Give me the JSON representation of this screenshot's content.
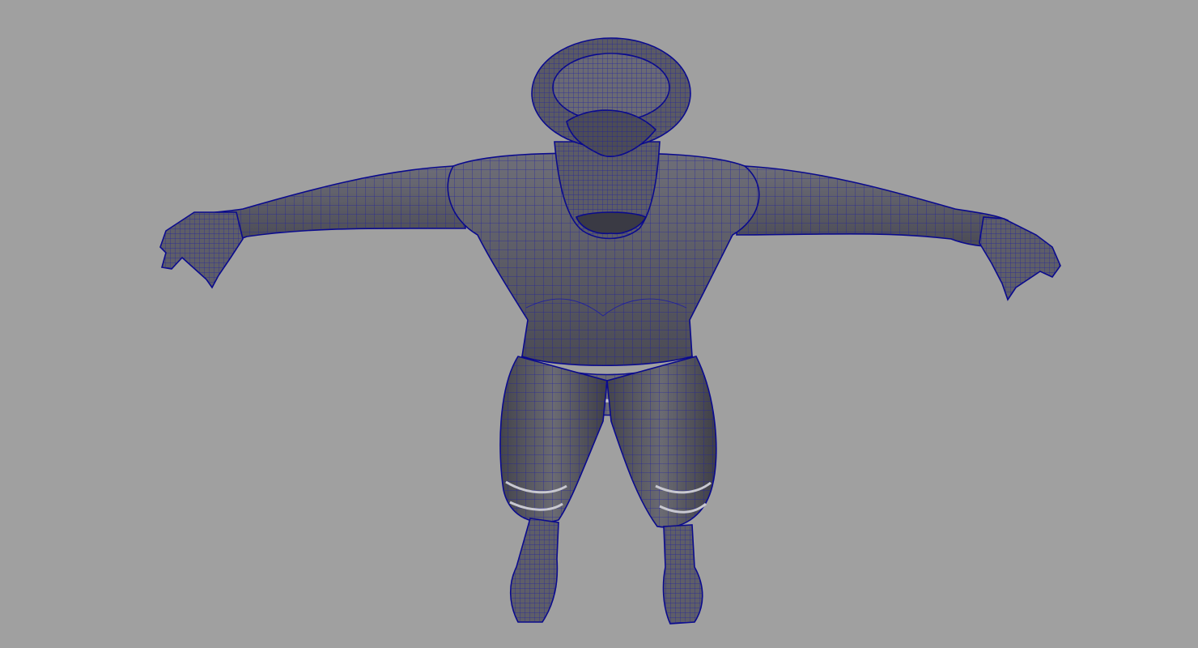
{
  "viewport": {
    "background_color": "#a0a0a0",
    "display_mode": "wireframe-on-shaded",
    "mesh_fill_color": "#5a5a62",
    "wire_color": "#1a1aa6",
    "subject": "character-t-pose"
  }
}
